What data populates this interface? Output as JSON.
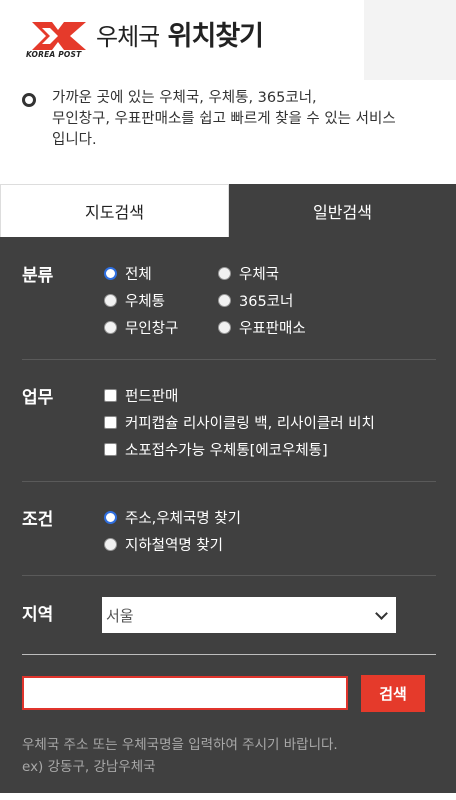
{
  "header": {
    "brand_text": "KOREA POST",
    "title_prefix": "우체국",
    "title_main": "위치찾기"
  },
  "intro": {
    "text": "가까운 곳에 있는 우체국, 우체통, 365코너,\n무인창구, 우표판매소를 쉽고 빠르게 찾을 수 있는 서비스\n입니다."
  },
  "tabs": {
    "map_search": "지도검색",
    "general_search": "일반검색"
  },
  "category": {
    "label": "분류",
    "options": [
      "전체",
      "우체국",
      "우체통",
      "365코너",
      "무인창구",
      "우표판매소"
    ],
    "selected": "전체"
  },
  "services": {
    "label": "업무",
    "options": [
      "펀드판매",
      "커피캡슐 리사이클링 백, 리사이클러 비치",
      "소포접수가능 우체통[에코우체통]"
    ]
  },
  "condition": {
    "label": "조건",
    "options": [
      "주소,우체국명 찾기",
      "지하철역명 찾기"
    ],
    "selected": "주소,우체국명 찾기"
  },
  "region": {
    "label": "지역",
    "selected": "서울"
  },
  "search": {
    "value": "",
    "button_label": "검색",
    "help_line1": "우체국 주소 또는 우체국명을 입력하여 주시기 바랍니다.",
    "help_line2": "ex) 강동구, 강남우체국"
  },
  "colors": {
    "panel_bg": "#404040",
    "accent_red": "#e53a2b",
    "radio_selected": "#2f6fe0"
  }
}
